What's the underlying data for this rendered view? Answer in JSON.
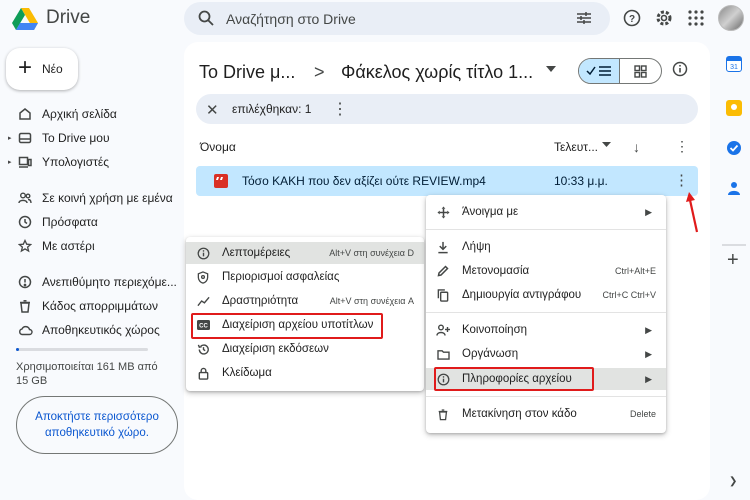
{
  "app": {
    "title": "Drive"
  },
  "search": {
    "placeholder": "Αναζήτηση στο Drive"
  },
  "sidebar": {
    "new_label": "Νέο",
    "items": [
      {
        "label": "Αρχική σελίδα",
        "icon": "home-icon"
      },
      {
        "label": "Το Drive μου",
        "icon": "my-drive-icon"
      },
      {
        "label": "Υπολογιστές",
        "icon": "computers-icon"
      },
      {
        "label": "Σε κοινή χρήση με εμένα",
        "icon": "shared-icon"
      },
      {
        "label": "Πρόσφατα",
        "icon": "clock-icon"
      },
      {
        "label": "Με αστέρι",
        "icon": "star-icon"
      },
      {
        "label": "Ανεπιθύμητο περιεχόμε...",
        "icon": "spam-icon"
      },
      {
        "label": "Κάδος απορριμμάτων",
        "icon": "trash-icon"
      },
      {
        "label": "Αποθηκευτικός χώρος",
        "icon": "cloud-icon"
      }
    ],
    "storage_text": "Χρησιμοποιείται 161 MB από 15 GB",
    "storage_fraction": 0.01,
    "get_storage": "Αποκτήστε περισσότερο αποθηκευτικό χώρο."
  },
  "breadcrumb": {
    "root": "Το Drive μ...",
    "separator": ">",
    "current": "Φάκελος χωρίς τίτλο 1..."
  },
  "selection": {
    "count_label": "επιλέχθηκαν: 1"
  },
  "table": {
    "col_name": "Όνομα",
    "col_modified": "Τελευτ...",
    "rows": [
      {
        "name": "Τόσο ΚΑΚΗ που δεν αξίζει ούτε REVIEW.mp4",
        "modified": "10:33 μ.μ."
      }
    ]
  },
  "context_menu": {
    "items": [
      {
        "label": "Άνοιγμα με",
        "icon": "open-with-icon",
        "shortcut": "",
        "submenu": true
      },
      {
        "label": "Λήψη",
        "icon": "download-icon",
        "shortcut": ""
      },
      {
        "label": "Μετονομασία",
        "icon": "rename-icon",
        "shortcut": "Ctrl+Alt+E"
      },
      {
        "label": "Δημιουργία αντιγράφου",
        "icon": "copy-icon",
        "shortcut": "Ctrl+C Ctrl+V"
      },
      {
        "label": "Κοινοποίηση",
        "icon": "share-icon",
        "shortcut": "",
        "submenu": true
      },
      {
        "label": "Οργάνωση",
        "icon": "folder-icon",
        "shortcut": "",
        "submenu": true
      },
      {
        "label": "Πληροφορίες αρχείου",
        "icon": "info-icon",
        "shortcut": "",
        "submenu": true
      },
      {
        "label": "Μετακίνηση στον κάδο",
        "icon": "trash-icon",
        "shortcut": "Delete"
      }
    ]
  },
  "submenu": {
    "items": [
      {
        "label": "Λεπτομέρειες",
        "icon": "info-icon",
        "shortcut": "Alt+V στη συνέχεια D"
      },
      {
        "label": "Περιορισμοί ασφαλείας",
        "icon": "shield-icon",
        "shortcut": ""
      },
      {
        "label": "Δραστηριότητα",
        "icon": "activity-icon",
        "shortcut": "Alt+V στη συνέχεια A"
      },
      {
        "label": "Διαχείριση αρχείου υποτίτλων",
        "icon": "captions-icon",
        "shortcut": ""
      },
      {
        "label": "Διαχείριση εκδόσεων",
        "icon": "history-icon",
        "shortcut": ""
      },
      {
        "label": "Κλείδωμα",
        "icon": "lock-icon",
        "shortcut": ""
      }
    ]
  },
  "colors": {
    "accent": "#0b57d0",
    "selected_row": "#c2e7ff",
    "annotation": "#e01b1b"
  }
}
